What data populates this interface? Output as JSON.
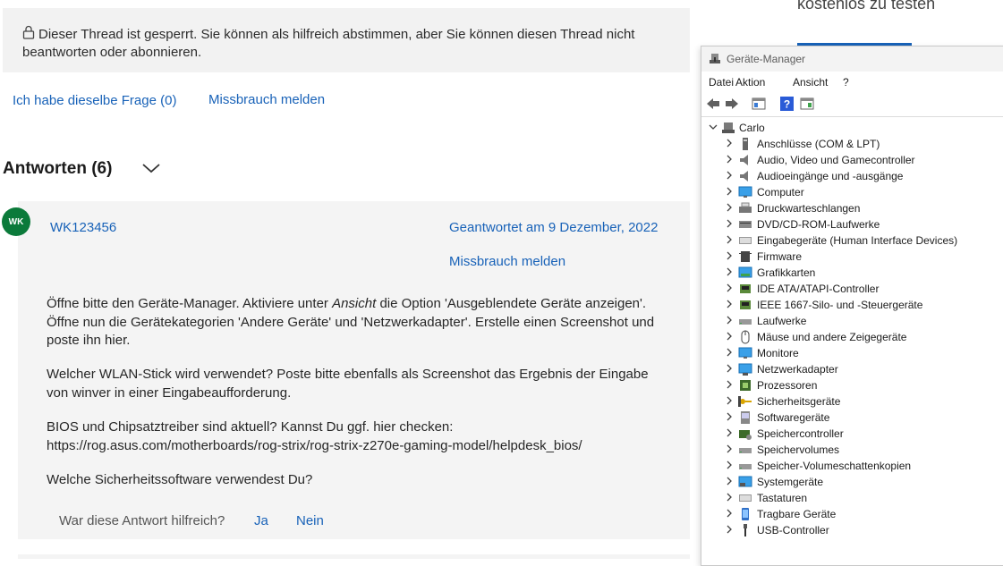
{
  "locked_notice": "Dieser Thread ist gesperrt. Sie können als hilfreich abstimmen, aber Sie können diesen Thread nicht beantworten oder abonnieren.",
  "actions": {
    "same_question": "Ich habe dieselbe Frage (0)",
    "report": "Missbrauch melden"
  },
  "answers_heading": "Antworten (6)",
  "answer": {
    "avatar_initials": "WK",
    "author": "WK123456",
    "date": "Geantwortet am 9 Dezember, 2022",
    "report": "Missbrauch melden",
    "p1_before": "Öffne bitte den Geräte-Manager. Aktiviere unter ",
    "p1_italic": "Ansicht",
    "p1_after": " die Option 'Ausgeblendete Geräte anzeigen'. Öffne nun die Gerätekategorien 'Andere Geräte' und 'Netzwerkadapter'. Erstelle einen Screenshot und poste ihn hier.",
    "p2": "Welcher WLAN-Stick wird verwendet? Poste bitte ebenfalls als Screenshot das Ergebnis der Eingabe von winver in einer Eingabeaufforderung.",
    "p3": "BIOS und Chipsatztreiber sind aktuell? Kannst Du ggf. hier checken: https://rog.asus.com/motherboards/rog-strix/rog-strix-z270e-gaming-model/helpdesk_bios/",
    "p4": "Welche Sicherheitssoftware verwendest Du?",
    "helpful_question": "War diese Antwort hilfreich?",
    "yes": "Ja",
    "no": "Nein"
  },
  "promo_text": "kostenlos zu testen",
  "device_manager": {
    "title": "Geräte-Manager",
    "menu": [
      "Datei",
      "Aktion",
      "Ansicht",
      "?"
    ],
    "root": "Carlo",
    "items": [
      {
        "label": "Anschlüsse (COM & LPT)",
        "icon": "port-icon"
      },
      {
        "label": "Audio, Video und Gamecontroller",
        "icon": "speaker-icon"
      },
      {
        "label": "Audioeingänge und -ausgänge",
        "icon": "speaker-icon"
      },
      {
        "label": "Computer",
        "icon": "monitor-icon"
      },
      {
        "label": "Druckwarteschlangen",
        "icon": "printer-icon"
      },
      {
        "label": "DVD/CD-ROM-Laufwerke",
        "icon": "dvd-drive-icon"
      },
      {
        "label": "Eingabegeräte (Human Interface Devices)",
        "icon": "keyboard-icon"
      },
      {
        "label": "Firmware",
        "icon": "chip-icon"
      },
      {
        "label": "Grafikkarten",
        "icon": "display-adapter-icon"
      },
      {
        "label": "IDE ATA/ATAPI-Controller",
        "icon": "controller-icon"
      },
      {
        "label": "IEEE 1667-Silo- und -Steuergeräte",
        "icon": "controller-icon"
      },
      {
        "label": "Laufwerke",
        "icon": "drive-icon"
      },
      {
        "label": "Mäuse und andere Zeigegeräte",
        "icon": "mouse-icon"
      },
      {
        "label": "Monitore",
        "icon": "monitor-icon"
      },
      {
        "label": "Netzwerkadapter",
        "icon": "network-icon"
      },
      {
        "label": "Prozessoren",
        "icon": "processor-icon"
      },
      {
        "label": "Sicherheitsgeräte",
        "icon": "key-icon"
      },
      {
        "label": "Softwaregeräte",
        "icon": "software-device-icon"
      },
      {
        "label": "Speichercontroller",
        "icon": "storage-controller-icon"
      },
      {
        "label": "Speichervolumes",
        "icon": "drive-icon"
      },
      {
        "label": "Speicher-Volumeschattenkopien",
        "icon": "drive-icon"
      },
      {
        "label": "Systemgeräte",
        "icon": "system-device-icon"
      },
      {
        "label": "Tastaturen",
        "icon": "keyboard-icon"
      },
      {
        "label": "Tragbare Geräte",
        "icon": "portable-device-icon"
      },
      {
        "label": "USB-Controller",
        "icon": "usb-icon"
      }
    ]
  },
  "colors": {
    "link": "#1862b8",
    "avatar": "#0b7a3a",
    "notice_bg": "#f2f2f2",
    "card_bg": "#f4f4f4"
  }
}
